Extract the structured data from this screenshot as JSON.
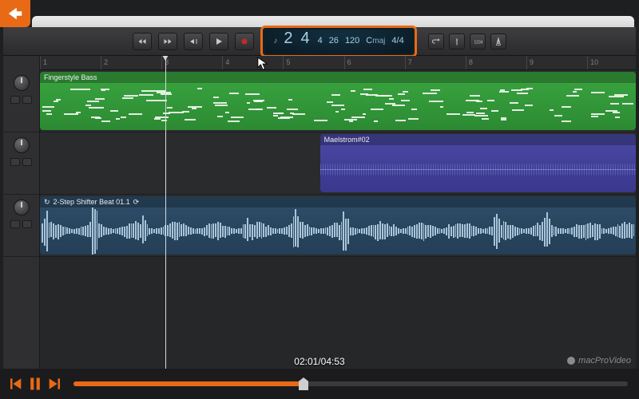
{
  "colors": {
    "accent": "#e86a16"
  },
  "ruler": {
    "start": 1,
    "end": 10
  },
  "lcd": {
    "bars": "2",
    "beats": "4",
    "division": "4",
    "ticks": "26",
    "tempo": "120",
    "key_root": "C",
    "key_mode": "maj",
    "sig_num": "4",
    "sig_den": "4"
  },
  "tracks": [
    {
      "name": "Fingerstyle Bass",
      "type": "midi",
      "region": {
        "start_pct": 0,
        "end_pct": 100
      }
    },
    {
      "name": "Maelstrom#02",
      "type": "synth",
      "region": {
        "start_pct": 47,
        "end_pct": 100
      }
    },
    {
      "name": "2-Step Shifter Beat 01.1",
      "type": "audio",
      "looped": true,
      "region": {
        "start_pct": 0,
        "end_pct": 100
      }
    }
  ],
  "playhead_pct": 21,
  "video": {
    "current": "02:01",
    "duration": "04:53",
    "progress_pct": 41.5
  },
  "brand": "macProVideo"
}
